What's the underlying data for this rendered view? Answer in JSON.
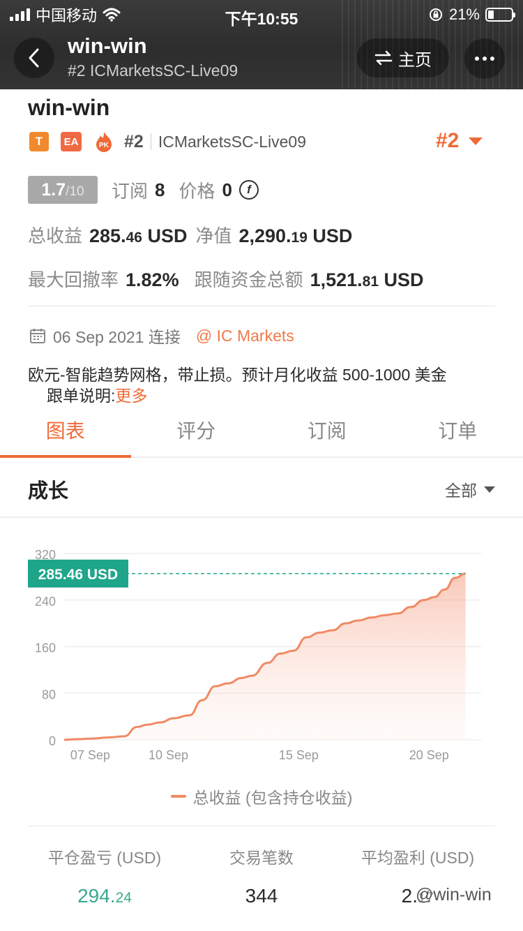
{
  "status_bar": {
    "carrier": "中国移动",
    "time": "下午10:55",
    "battery": "21%"
  },
  "header": {
    "title": "win-win",
    "subtitle": "#2 ICMarketsSC-Live09",
    "home_label": "主页"
  },
  "profile": {
    "name": "win-win",
    "badge_t": "T",
    "badge_ea": "EA",
    "badge_pk": "PK",
    "rank": "#2",
    "server": "ICMarketsSC-Live09",
    "rank_big": "#2",
    "score": "1.7",
    "score_max": "/10",
    "subscribe_label": "订阅",
    "subscribe_count": "8",
    "price_label": "价格",
    "price_value": "0",
    "total_profit_label": "总收益",
    "total_profit_int": "285.",
    "total_profit_dec": "46",
    "total_profit_unit": " USD",
    "equity_label": "净值",
    "equity_int": "2,290.",
    "equity_dec": "19",
    "equity_unit": " USD",
    "drawdown_label": "最大回撤率",
    "drawdown_value": "1.82%",
    "follow_label": "跟随资金总额",
    "follow_int": "1,521.",
    "follow_dec": "81",
    "follow_unit": " USD",
    "connect_date": "06 Sep 2021 连接",
    "broker": "@ IC Markets",
    "description": "欧元-智能趋势网格，带止损。预计月化收益 500-1000 美金",
    "follow_note_label": "跟单说明:",
    "follow_note_more": "更多"
  },
  "tabs": [
    "图表",
    "评分",
    "订阅",
    "订单"
  ],
  "growth": {
    "title": "成长",
    "range": "全部"
  },
  "colors": {
    "accent": "#ef6a36",
    "line": "#ef8a64",
    "marker": "#1ea58a",
    "green_value": "#3aaa8a"
  },
  "chart_data": {
    "type": "area",
    "ylim": [
      0,
      320
    ],
    "y_ticks": [
      "0",
      "80",
      "160",
      "240",
      "320"
    ],
    "x_ticks": [
      {
        "label": "07 Sep",
        "x": 7
      },
      {
        "label": "10 Sep",
        "x": 10
      },
      {
        "label": "15 Sep",
        "x": 15
      },
      {
        "label": "20 Sep",
        "x": 20
      }
    ],
    "xlim": [
      6,
      22
    ],
    "current_value_label": "285.46 USD",
    "current_value": 285.46,
    "series": [
      {
        "name": "总收益 (包含持仓收益)",
        "x": [
          6.0,
          6.5,
          7.0,
          7.7,
          8.3,
          8.8,
          9.2,
          9.7,
          10.2,
          10.8,
          11.3,
          11.8,
          12.3,
          12.8,
          13.2,
          13.8,
          14.3,
          14.8,
          15.3,
          15.8,
          16.3,
          16.8,
          17.3,
          17.8,
          18.3,
          18.8,
          19.3,
          19.8,
          20.2,
          20.6,
          21.0,
          21.4
        ],
        "values": [
          0,
          1,
          2,
          4,
          6,
          22,
          26,
          30,
          37,
          42,
          68,
          92,
          97,
          106,
          110,
          132,
          148,
          153,
          176,
          184,
          188,
          200,
          205,
          210,
          214,
          217,
          228,
          240,
          245,
          258,
          278,
          285.46
        ]
      }
    ],
    "legend": "bottom"
  },
  "bottom_stats": [
    {
      "label": "平仓盈亏 (USD)",
      "int": "294.",
      "dec": "24"
    },
    {
      "label": "交易笔数",
      "int": "344",
      "dec": ""
    },
    {
      "label": "平均盈利 (USD)",
      "int": "2.",
      "dec": "17"
    }
  ],
  "watermark": "@win-win"
}
